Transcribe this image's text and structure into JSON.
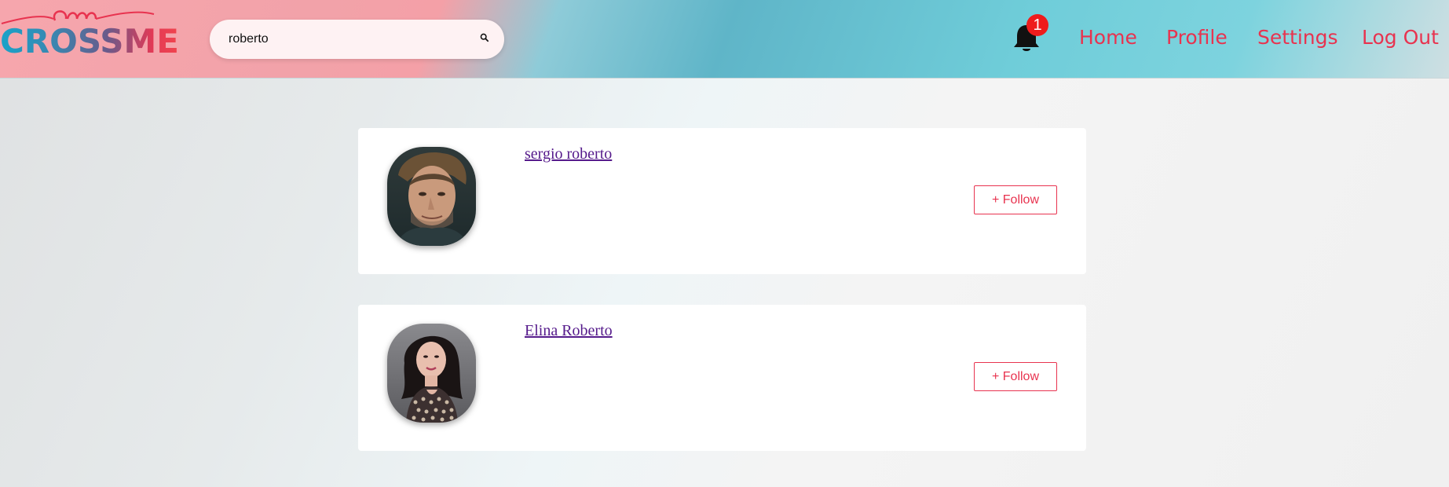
{
  "header": {
    "logo_script": "cm",
    "logo_text": "CROSSME",
    "search": {
      "value": "roberto",
      "placeholder": ""
    },
    "notifications": {
      "count": "1"
    },
    "nav": [
      "Home",
      "Profile",
      "Settings",
      "Log Out"
    ]
  },
  "results": [
    {
      "name": "sergio roberto",
      "follow_label": "+ Follow"
    },
    {
      "name": "Elina Roberto",
      "follow_label": "+ Follow"
    }
  ],
  "colors": {
    "accent": "#e8334f",
    "link": "#551a8b",
    "badge": "#ee1c1c"
  }
}
